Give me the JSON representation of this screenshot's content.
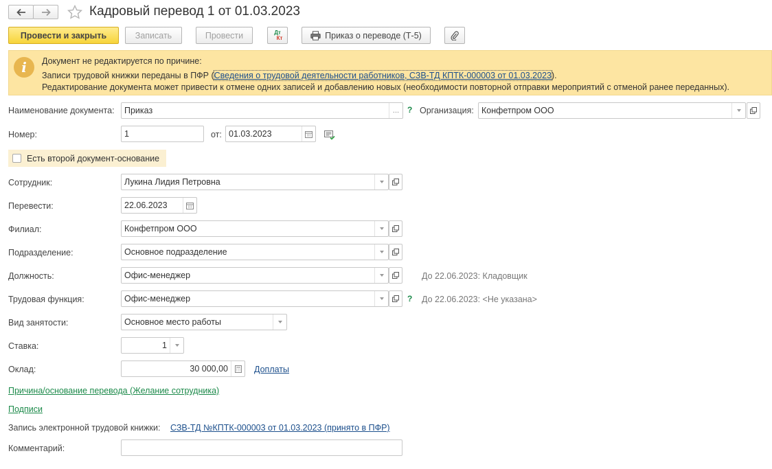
{
  "window": {
    "title": "Кадровый перевод 1 от 01.03.2023"
  },
  "toolbar": {
    "post_close": "Провести и закрыть",
    "save": "Записать",
    "post": "Провести",
    "dtkt_top": "Дт",
    "dtkt_bottom": "Кт",
    "print_order": "Приказ о переводе (Т-5)"
  },
  "info": {
    "heading": "Документ не редактируется по причине:",
    "line1_prefix": "Записи трудовой книжки переданы в ПФР (",
    "line1_link": "Сведения о трудовой деятельности работников, СЗВ-ТД КПТК-000003 от 01.03.2023",
    "line1_suffix": ").",
    "line2": "Редактирование документа может привести к отмене одних записей и добавлению новых (необходимости повторной отправки мероприятий с отменой ранее переданных)."
  },
  "form": {
    "doc_name_label": "Наименование документа:",
    "doc_name_value": "Приказ",
    "doc_name_btn": "...",
    "help_mark": "?",
    "org_label": "Организация:",
    "org_value": "Конфетпром ООО",
    "number_label": "Номер:",
    "number_value": "1",
    "from_label": "от:",
    "from_value": "01.03.2023",
    "second_doc_label": "Есть второй документ-основание",
    "employee_label": "Сотрудник:",
    "employee_value": "Лукина Лидия Петровна",
    "transfer_label": "Перевести:",
    "transfer_value": "22.06.2023",
    "branch_label": "Филиал:",
    "branch_value": "Конфетпром ООО",
    "dept_label": "Подразделение:",
    "dept_value": "Основное подразделение",
    "position_label": "Должность:",
    "position_value": "Офис-менеджер",
    "position_hint": "До 22.06.2023: Кладовщик",
    "labor_func_label": "Трудовая функция:",
    "labor_func_value": "Офис-менеджер",
    "labor_func_hint": "До 22.06.2023: <Не указана>",
    "employment_label": "Вид занятости:",
    "employment_value": "Основное место работы",
    "rate_label": "Ставка:",
    "rate_value": "1",
    "salary_label": "Оклад:",
    "salary_value": "30 000,00",
    "surcharges_link": "Доплаты",
    "reason_link": "Причина/основание перевода (Желание сотрудника)",
    "signatures_link": "Подписи",
    "etk_label": "Запись электронной трудовой книжки:",
    "etk_link": "СЗВ-ТД №КПТК-000003 от 01.03.2023 (принято в ПФР)",
    "comment_label": "Комментарий:",
    "comment_value": ""
  },
  "colors": {
    "accent_button": "#f7d43a",
    "info_background": "#fde5a2",
    "link": "#1c4f8c",
    "link_green": "#1c8a4a"
  }
}
